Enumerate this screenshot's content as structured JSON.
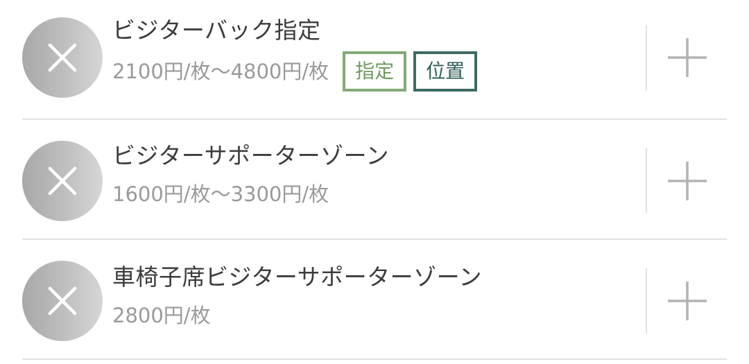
{
  "items": [
    {
      "name": "ビジターバック指定",
      "price": "2100円/枚〜4800円/枚",
      "tags": [
        "指定",
        "位置"
      ]
    },
    {
      "name": "ビジターサポーターゾーン",
      "price": "1600円/枚〜3300円/枚",
      "tags": []
    },
    {
      "name": "車椅子席ビジターサポーターゾーン",
      "price": "2800円/枚",
      "tags": []
    }
  ],
  "icons": {
    "remove": "close-icon",
    "add": "plus-icon"
  },
  "colors": {
    "tag_designated": "#82aa74",
    "tag_location": "#3d6b66",
    "avatar_gradient_start": "#a8a8a8",
    "avatar_gradient_end": "#d6d6d6",
    "title_text": "#3c3c3c",
    "price_text": "#9a9a9a"
  }
}
